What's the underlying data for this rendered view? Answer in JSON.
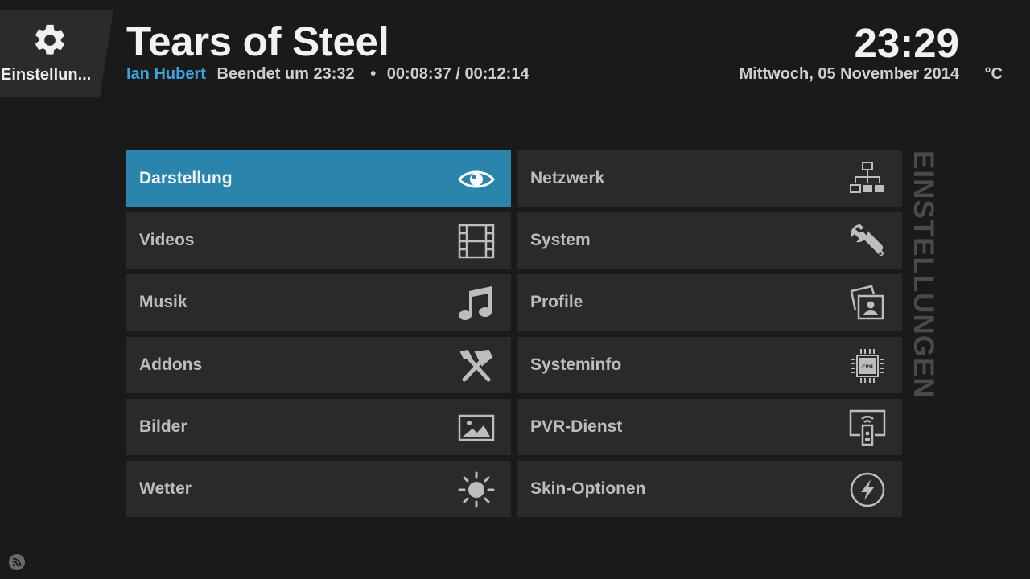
{
  "settings_tab": {
    "label": "Einstellun...",
    "icon": "gear-icon"
  },
  "header": {
    "title": "Tears of Steel",
    "director": "Ian Hubert",
    "ends_at": "Beendet um 23:32",
    "separator": "•",
    "progress": "00:08:37 / 00:12:14",
    "clock": "23:29",
    "date": "Mittwoch, 05 November 2014",
    "temperature": "°C"
  },
  "section_title": "EINSTELLUNGEN",
  "tiles": [
    {
      "label": "Darstellung",
      "icon": "eye-icon"
    },
    {
      "label": "Netzwerk",
      "icon": "network-icon"
    },
    {
      "label": "Videos",
      "icon": "film-icon"
    },
    {
      "label": "System",
      "icon": "wrench-icon"
    },
    {
      "label": "Musik",
      "icon": "music-note-icon"
    },
    {
      "label": "Profile",
      "icon": "profile-photo-icon"
    },
    {
      "label": "Addons",
      "icon": "tools-icon"
    },
    {
      "label": "Systeminfo",
      "icon": "cpu-icon"
    },
    {
      "label": "Bilder",
      "icon": "picture-icon"
    },
    {
      "label": "PVR-Dienst",
      "icon": "pvr-remote-icon"
    },
    {
      "label": "Wetter",
      "icon": "sun-icon"
    },
    {
      "label": "Skin-Optionen",
      "icon": "lightning-circle-icon"
    }
  ],
  "colors": {
    "accent": "#2a84ab",
    "director": "#3aa3e0",
    "tile": "#2a2a2a",
    "background": "#1a1a1a"
  },
  "bottom_icon": "rss-icon"
}
